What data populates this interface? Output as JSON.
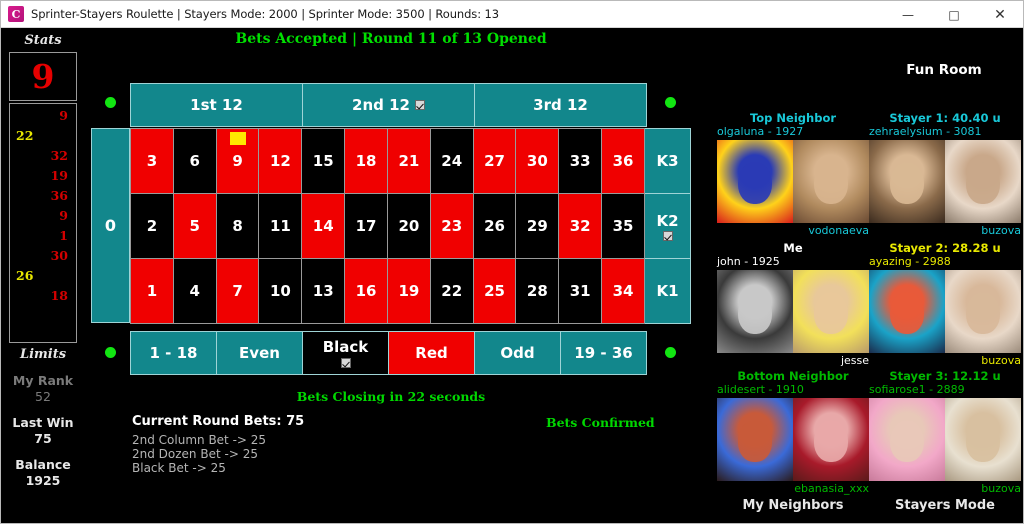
{
  "window": {
    "title": "Sprinter-Stayers Roulette | Stayers Mode: 2000 | Sprinter Mode: 3500 | Rounds: 13",
    "app_icon": "c-logo-icon",
    "minimize": "—",
    "maximize": "□",
    "close": "✕"
  },
  "stats": {
    "title": "Stats",
    "last_number": "9",
    "history": [
      {
        "right": "9",
        "left": ""
      },
      {
        "right": "",
        "left": "22"
      },
      {
        "right": "32",
        "left": ""
      },
      {
        "right": "19",
        "left": ""
      },
      {
        "right": "36",
        "left": ""
      },
      {
        "right": "9",
        "left": ""
      },
      {
        "right": "1",
        "left": ""
      },
      {
        "right": "30",
        "left": ""
      },
      {
        "right": "",
        "left": "26"
      },
      {
        "right": "18",
        "left": ""
      }
    ],
    "limits_title": "Limits",
    "limits": [
      {
        "label": "My Rank",
        "value": "52",
        "bright": false
      },
      {
        "label": "Last Win",
        "value": "75",
        "bright": true
      },
      {
        "label": "Balance",
        "value": "1925",
        "bright": true
      }
    ]
  },
  "table": {
    "status_top": "Bets Accepted | Round 11 of 13 Opened",
    "status_bottom": "Bets Closing in 22 seconds",
    "zero": "0",
    "dozens": [
      {
        "label": "1st 12",
        "checked": false
      },
      {
        "label": "2nd 12",
        "checked": true
      },
      {
        "label": "3rd 12",
        "checked": false
      }
    ],
    "rows": [
      {
        "numbers": [
          {
            "n": "3",
            "color": "red",
            "marker": false
          },
          {
            "n": "6",
            "color": "black",
            "marker": false
          },
          {
            "n": "9",
            "color": "red",
            "marker": true
          },
          {
            "n": "12",
            "color": "red",
            "marker": false
          },
          {
            "n": "15",
            "color": "black",
            "marker": false
          },
          {
            "n": "18",
            "color": "red",
            "marker": false
          },
          {
            "n": "21",
            "color": "red",
            "marker": false
          },
          {
            "n": "24",
            "color": "black",
            "marker": false
          },
          {
            "n": "27",
            "color": "red",
            "marker": false
          },
          {
            "n": "30",
            "color": "red",
            "marker": false
          },
          {
            "n": "33",
            "color": "black",
            "marker": false
          },
          {
            "n": "36",
            "color": "red",
            "marker": false
          }
        ],
        "column": {
          "label": "K3",
          "checked": false
        }
      },
      {
        "numbers": [
          {
            "n": "2",
            "color": "black",
            "marker": false
          },
          {
            "n": "5",
            "color": "red",
            "marker": false
          },
          {
            "n": "8",
            "color": "black",
            "marker": false
          },
          {
            "n": "11",
            "color": "black",
            "marker": false
          },
          {
            "n": "14",
            "color": "red",
            "marker": false
          },
          {
            "n": "17",
            "color": "black",
            "marker": false
          },
          {
            "n": "20",
            "color": "black",
            "marker": false
          },
          {
            "n": "23",
            "color": "red",
            "marker": false
          },
          {
            "n": "26",
            "color": "black",
            "marker": false
          },
          {
            "n": "29",
            "color": "black",
            "marker": false
          },
          {
            "n": "32",
            "color": "red",
            "marker": false
          },
          {
            "n": "35",
            "color": "black",
            "marker": false
          }
        ],
        "column": {
          "label": "K2",
          "checked": true
        }
      },
      {
        "numbers": [
          {
            "n": "1",
            "color": "red",
            "marker": false
          },
          {
            "n": "4",
            "color": "black",
            "marker": false
          },
          {
            "n": "7",
            "color": "red",
            "marker": false
          },
          {
            "n": "10",
            "color": "black",
            "marker": false
          },
          {
            "n": "13",
            "color": "black",
            "marker": false
          },
          {
            "n": "16",
            "color": "red",
            "marker": false
          },
          {
            "n": "19",
            "color": "red",
            "marker": false
          },
          {
            "n": "22",
            "color": "black",
            "marker": false
          },
          {
            "n": "25",
            "color": "red",
            "marker": false
          },
          {
            "n": "28",
            "color": "black",
            "marker": false
          },
          {
            "n": "31",
            "color": "black",
            "marker": false
          },
          {
            "n": "34",
            "color": "red",
            "marker": false
          }
        ],
        "column": {
          "label": "K1",
          "checked": false
        }
      }
    ],
    "outside": [
      {
        "label": "1 - 18",
        "style": "teal",
        "checked": false
      },
      {
        "label": "Even",
        "style": "teal",
        "checked": false
      },
      {
        "label": "Black",
        "style": "black",
        "checked": true
      },
      {
        "label": "Red",
        "style": "red",
        "checked": false
      },
      {
        "label": "Odd",
        "style": "teal",
        "checked": false
      },
      {
        "label": "19 - 36",
        "style": "teal",
        "checked": false
      }
    ]
  },
  "bets": {
    "header": "Current Round Bets: 75",
    "confirmed": "Bets Confirmed",
    "lines": [
      "2nd Column Bet -> 25",
      "2nd Dozen Bet -> 25",
      "Black Bet -> 25"
    ]
  },
  "right_panel": {
    "fun_room_title": "Fun Room",
    "footer_left": "My Neighbors",
    "footer_right": "Stayers Mode",
    "cards": [
      {
        "header": "Top Neighbor",
        "header_color": "#19c8d8",
        "user_top": "olgaluna -  1927",
        "user_bottom": "vodonaeva",
        "user_color": "#19c8d8"
      },
      {
        "header": "Stayer 1: 40.40 u",
        "header_color": "#19c8d8",
        "user_top": "zehraelysium -  3081",
        "user_bottom": "buzova",
        "user_color": "#19c8d8"
      },
      {
        "header": "Me",
        "header_color": "#ffffff",
        "user_top": "john - 1925",
        "user_bottom": "jesse",
        "user_color": "#ffffff"
      },
      {
        "header": "Stayer 2: 28.28 u",
        "header_color": "#e8e800",
        "user_top": "ayazing -  2988",
        "user_bottom": "buzova",
        "user_color": "#e8e800"
      },
      {
        "header": "Bottom Neighbor",
        "header_color": "#00b800",
        "user_top": "alidesert -  1910",
        "user_bottom": "ebanasia_xxx",
        "user_color": "#00b800"
      },
      {
        "header": "Stayer 3: 12.12 u",
        "header_color": "#00b800",
        "user_top": "sofiarose1 -  2889",
        "user_bottom": "buzova",
        "user_color": "#00b800"
      }
    ]
  },
  "colors": {
    "teal": "#12878c",
    "red": "#f00000",
    "green_text": "#00d800",
    "yellow_marker": "#ffe800"
  }
}
